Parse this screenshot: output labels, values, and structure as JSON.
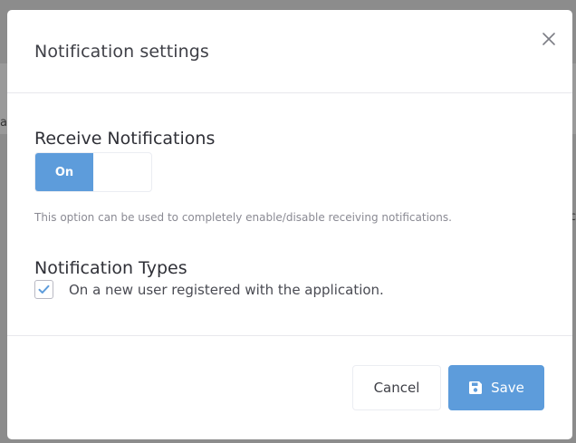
{
  "background": {
    "left_fragment": "a",
    "right_fragment": "c"
  },
  "modal": {
    "title": "Notification settings",
    "close_icon": "close-icon"
  },
  "receive": {
    "heading": "Receive Notifications",
    "toggle_on_label": "On",
    "toggle_state": true,
    "help_text": "This option can be used to completely enable/disable receiving notifications."
  },
  "types": {
    "heading": "Notification Types",
    "options": [
      {
        "label": "On a new user registered with the application.",
        "checked": true
      }
    ]
  },
  "footer": {
    "cancel_label": "Cancel",
    "save_label": "Save",
    "save_icon": "floppy-disk-icon"
  },
  "colors": {
    "primary": "#5d9cdb",
    "text_dark": "#3f4047",
    "text_muted": "#8a8a93",
    "overlay": "#8c8c8c"
  }
}
